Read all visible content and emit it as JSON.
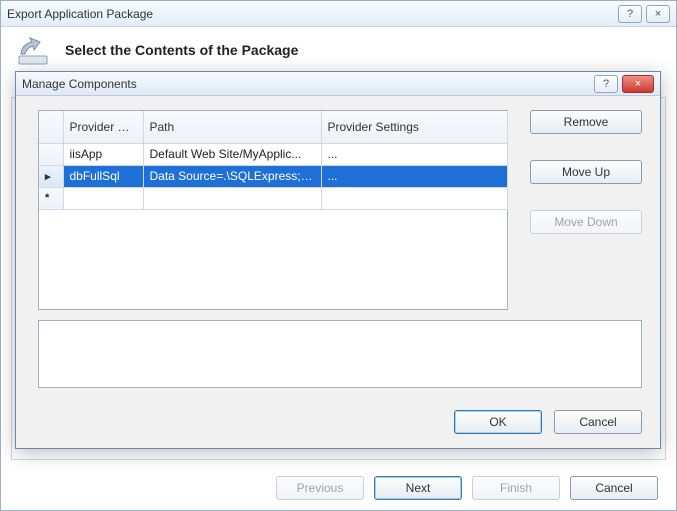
{
  "outer": {
    "title": "Export Application Package",
    "heading": "Select the Contents of the Package",
    "help": "?",
    "close": "×",
    "buttons": {
      "previous": "Previous",
      "next": "Next",
      "finish": "Finish",
      "cancel": "Cancel"
    }
  },
  "dialog": {
    "title": "Manage Components",
    "help": "?",
    "close": "×",
    "columns": {
      "provider": "Provider Name",
      "path": "Path",
      "settings": "Provider Settings"
    },
    "rows": [
      {
        "provider": "iisApp",
        "path": "Default Web Site/MyApplic...",
        "settings": "...",
        "selected": false,
        "marker": ""
      },
      {
        "provider": "dbFullSql",
        "path": "Data Source=.\\SQLExpress;Dat",
        "settings": "...",
        "selected": true,
        "marker": "▸"
      }
    ],
    "newRowMarker": "*",
    "buttons": {
      "remove": "Remove",
      "moveUp": "Move Up",
      "moveDown": "Move Down",
      "ok": "OK",
      "cancel": "Cancel"
    }
  }
}
